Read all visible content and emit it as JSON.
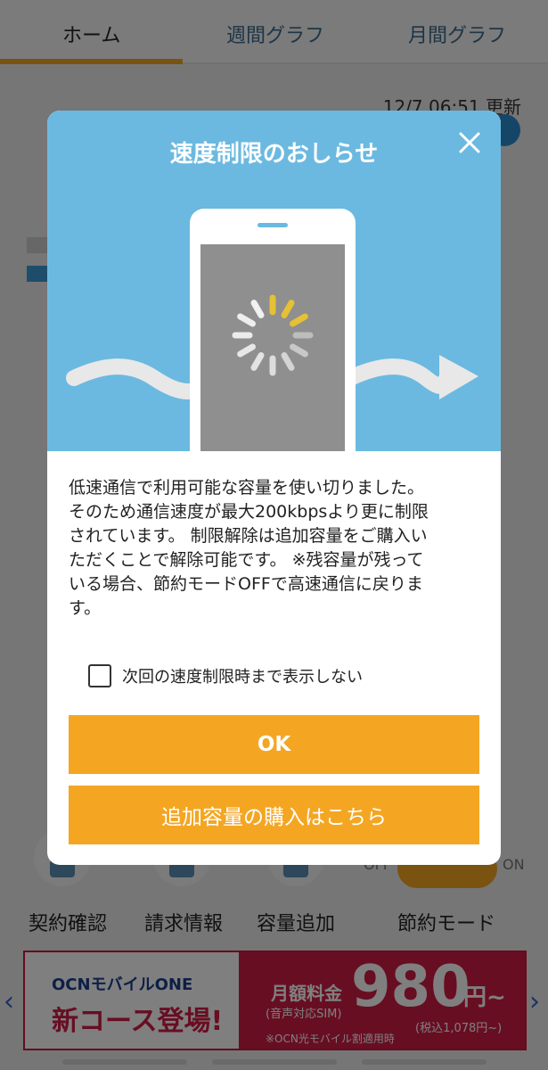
{
  "tabs": [
    {
      "label": "ホーム"
    },
    {
      "label": "週間グラフ"
    },
    {
      "label": "月間グラフ"
    }
  ],
  "update": {
    "text": "12/7 06:51 更新"
  },
  "toggle": {
    "off": "OFF",
    "on": "ON"
  },
  "menu": [
    {
      "label": "契約確認"
    },
    {
      "label": "請求情報"
    },
    {
      "label": "容量追加"
    },
    {
      "label": "節約モード"
    }
  ],
  "banner": {
    "brand": "OCNモバイルONE",
    "headline": "新コース登場!",
    "monthly": "月額料金",
    "sim": "(音声対応SIM)",
    "price": "980",
    "yen": "円~",
    "tax": "(税込1,078円~)",
    "note": "※OCN光モバイル割適用時"
  },
  "modal": {
    "title": "速度制限のおしらせ",
    "body_lines": [
      "低速通信で利用可能な容量を使い切りました。",
      "そのため通信速度が最大200kbpsより更に制限",
      "されています。 制限解除は追加容量をご購入い",
      "ただくことで解除可能です。 ※残容量が残って",
      "いる場合、節約モードOFFで高速通信に戻りま",
      "す。"
    ],
    "checkbox_label": "次回の速度制限時まで表示しない",
    "ok_label": "OK",
    "buy_label": "追加容量の購入はこちら"
  },
  "colors": {
    "accent": "#f4a623",
    "header_bg": "#6bb9e0",
    "banner_red": "#d01c45"
  },
  "icons": [
    "close-icon",
    "phone-illustration",
    "loading-spinner-icon",
    "wave-arrow-icon",
    "checkbox-icon",
    "chevron-left-icon",
    "chevron-right-icon"
  ]
}
